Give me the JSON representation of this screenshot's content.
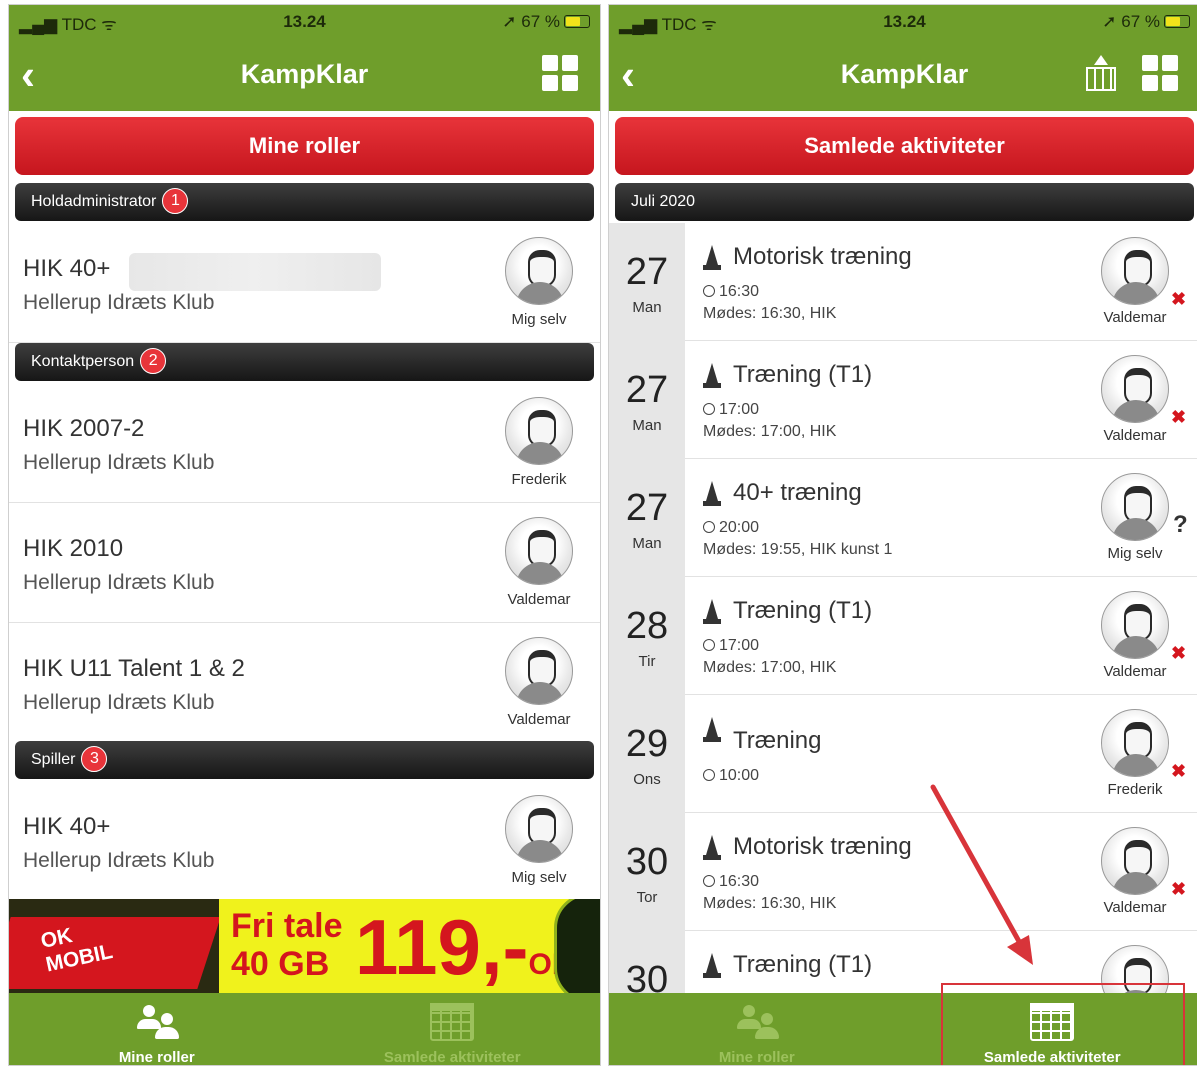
{
  "status": {
    "carrier": "TDC",
    "time": "13.24",
    "battery": "67 %"
  },
  "left": {
    "app_title": "KampKlar",
    "header_button": "Mine roller",
    "sections": [
      {
        "label": "Holdadministrator",
        "badge": "1"
      },
      {
        "label": "Kontaktperson",
        "badge": "2"
      },
      {
        "label": "Spiller",
        "badge": "3"
      }
    ],
    "rows": [
      {
        "team": "HIK 40+",
        "club": "Hellerup Idræts Klub",
        "person": "Mig selv"
      },
      {
        "team": "HIK 2007-2",
        "club": "Hellerup Idræts Klub",
        "person": "Frederik"
      },
      {
        "team": "HIK 2010",
        "club": "Hellerup Idræts Klub",
        "person": "Valdemar"
      },
      {
        "team": "HIK U11 Talent 1 & 2",
        "club": "Hellerup Idræts Klub",
        "person": "Valdemar"
      },
      {
        "team": "HIK 40+",
        "club": "Hellerup Idræts Klub",
        "person": "Mig selv"
      }
    ],
    "ad": {
      "brand_line1": "OK",
      "brand_line2": "MOBIL",
      "line1": "Fri tale",
      "line2": "40 GB",
      "price": "119,-",
      "price_suffix": "OK"
    },
    "tabs": [
      {
        "label": "Mine roller",
        "icon": "people-icon",
        "active": true
      },
      {
        "label": "Samlede aktiviteter",
        "icon": "calendar-icon",
        "active": false
      }
    ]
  },
  "right": {
    "app_title": "KampKlar",
    "header_button": "Samlede aktiviteter",
    "month": "Juli 2020",
    "activities": [
      {
        "day": "27",
        "weekday": "Man",
        "title": "Motorisk træning",
        "time": "16:30",
        "meet": "Mødes: 16:30, HIK",
        "person": "Valdemar",
        "status": "✖"
      },
      {
        "day": "27",
        "weekday": "Man",
        "title": "Træning (T1)",
        "time": "17:00",
        "meet": "Mødes: 17:00, HIK",
        "person": "Valdemar",
        "status": "✖"
      },
      {
        "day": "27",
        "weekday": "Man",
        "title": "40+ træning",
        "time": "20:00",
        "meet": "Mødes: 19:55, HIK kunst 1",
        "person": "Mig selv",
        "status": "?"
      },
      {
        "day": "28",
        "weekday": "Tir",
        "title": "Træning (T1)",
        "time": "17:00",
        "meet": "Mødes: 17:00, HIK",
        "person": "Valdemar",
        "status": "✖"
      },
      {
        "day": "29",
        "weekday": "Ons",
        "title": "Træning",
        "time": "10:00",
        "meet": "",
        "person": "Frederik",
        "status": "✖"
      },
      {
        "day": "30",
        "weekday": "Tor",
        "title": "Motorisk træning",
        "time": "16:30",
        "meet": "Mødes: 16:30, HIK",
        "person": "Valdemar",
        "status": "✖"
      },
      {
        "day": "30",
        "weekday": "",
        "title": "Træning (T1)",
        "time": "",
        "meet": "",
        "person": "",
        "status": ""
      }
    ],
    "tabs": [
      {
        "label": "Mine roller",
        "icon": "people-icon",
        "active": false
      },
      {
        "label": "Samlede aktiviteter",
        "icon": "calendar-icon",
        "active": true
      }
    ]
  },
  "colors": {
    "brand_green": "#6f9e2b",
    "header_red": "#d4161e",
    "section_dark": "#222222",
    "annotation_red": "#d8343a"
  }
}
